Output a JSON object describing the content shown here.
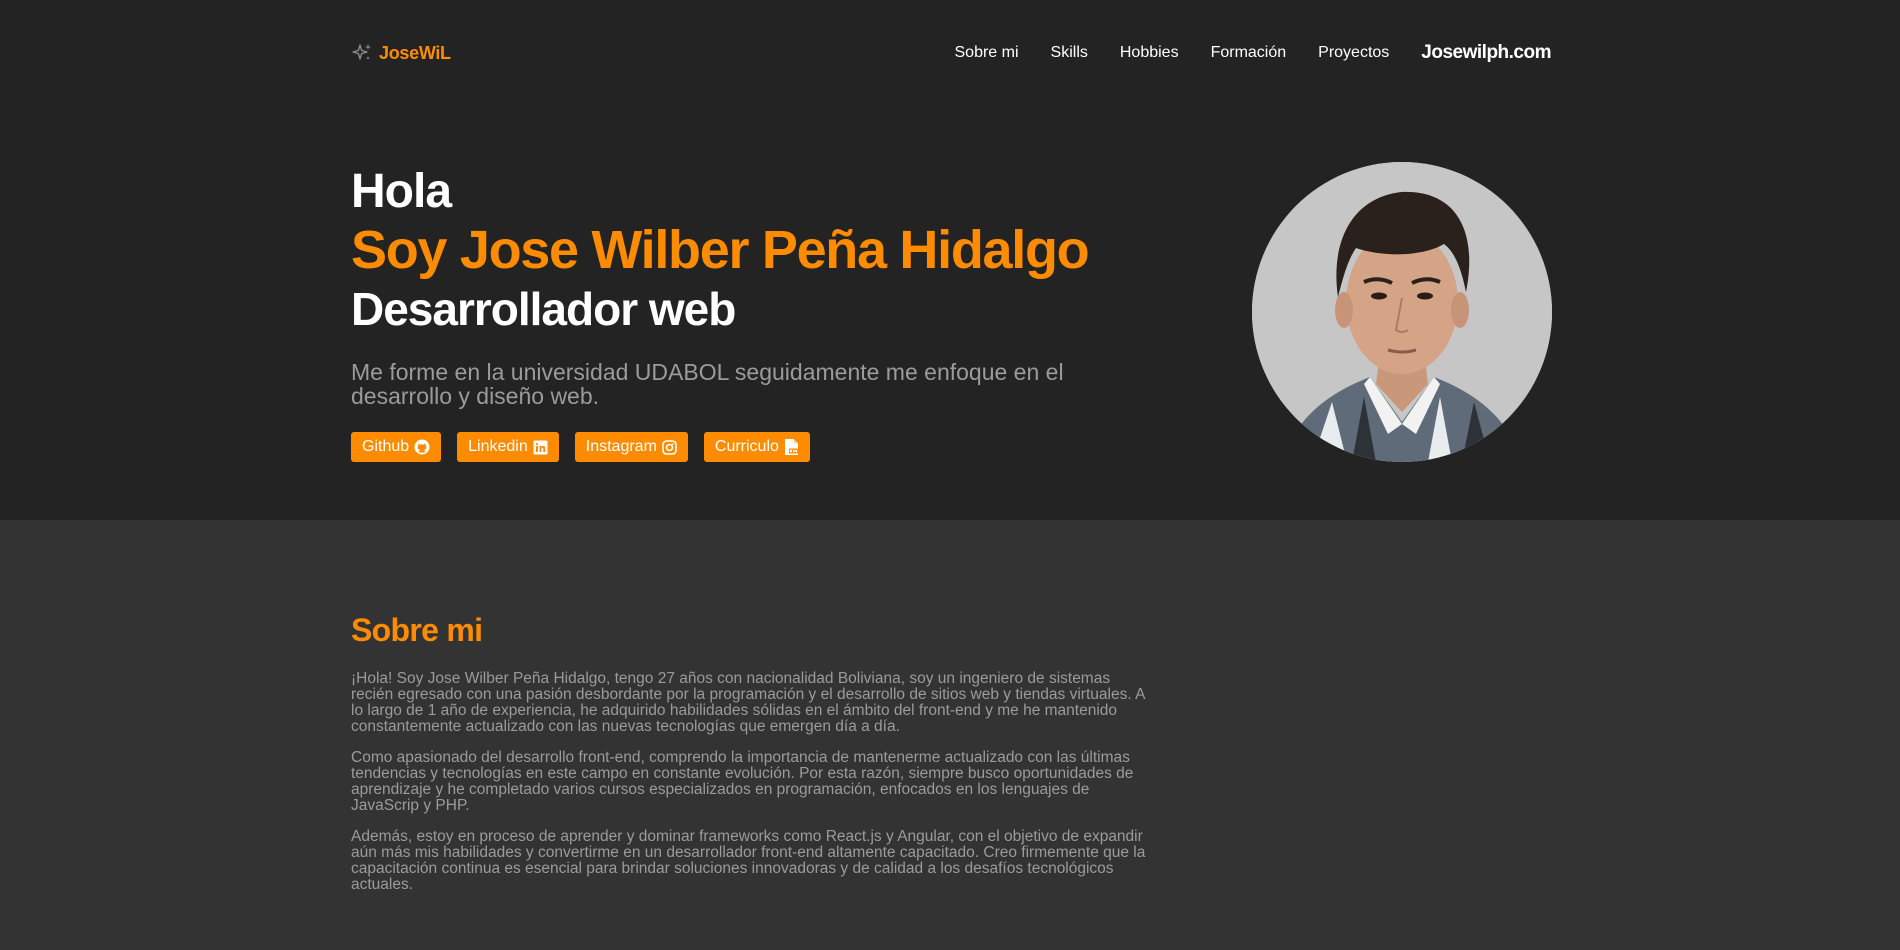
{
  "nav": {
    "logo_text": "JoseWiL",
    "links": [
      "Sobre mi",
      "Skills",
      "Hobbies",
      "Formación",
      "Proyectos"
    ],
    "brand_link": "Josewilph.com"
  },
  "hero": {
    "greeting": "Hola",
    "name": "Soy Jose Wilber Peña Hidalgo",
    "role": "Desarrollador web",
    "intro": "Me forme en la universidad UDABOL seguidamente me enfoque en el desarrollo y diseño web.",
    "buttons": [
      {
        "label": "Github",
        "icon": "github-icon"
      },
      {
        "label": "Linkedin",
        "icon": "linkedin-icon"
      },
      {
        "label": "Instagram",
        "icon": "instagram-icon"
      },
      {
        "label": "Curriculo",
        "icon": "pdf-file-icon"
      }
    ]
  },
  "about": {
    "title": "Sobre mi",
    "paragraphs": [
      "¡Hola! Soy Jose Wilber Peña Hidalgo, tengo 27 años con nacionalidad Boliviana, soy un ingeniero de sistemas recién egresado con una pasión desbordante por la programación y el desarrollo de sitios web y tiendas virtuales. A lo largo de 1 año de experiencia, he adquirido habilidades sólidas en el ámbito del front-end y me he mantenido constantemente actualizado con las nuevas tecnologías que emergen día a día.",
      "Como apasionado del desarrollo front-end, comprendo la importancia de mantenerme actualizado con las últimas tendencias y tecnologías en este campo en constante evolución. Por esta razón, siempre busco oportunidades de aprendizaje y he completado varios cursos especializados en programación, enfocados en los lenguajes de JavaScrip y PHP.",
      "Además, estoy en proceso de aprender y dominar frameworks como React.js y Angular, con el objetivo de expandir aún más mis habilidades y convertirme en un desarrollador front-end altamente capacitado. Creo firmemente que la capacitación continua es esencial para brindar soluciones innovadoras y de calidad a los desafíos tecnológicos actuales."
    ]
  },
  "colors": {
    "accent": "#ff8c00",
    "hero_background": "#232323",
    "about_background": "#333333",
    "muted_text": "#9b9b9b"
  }
}
